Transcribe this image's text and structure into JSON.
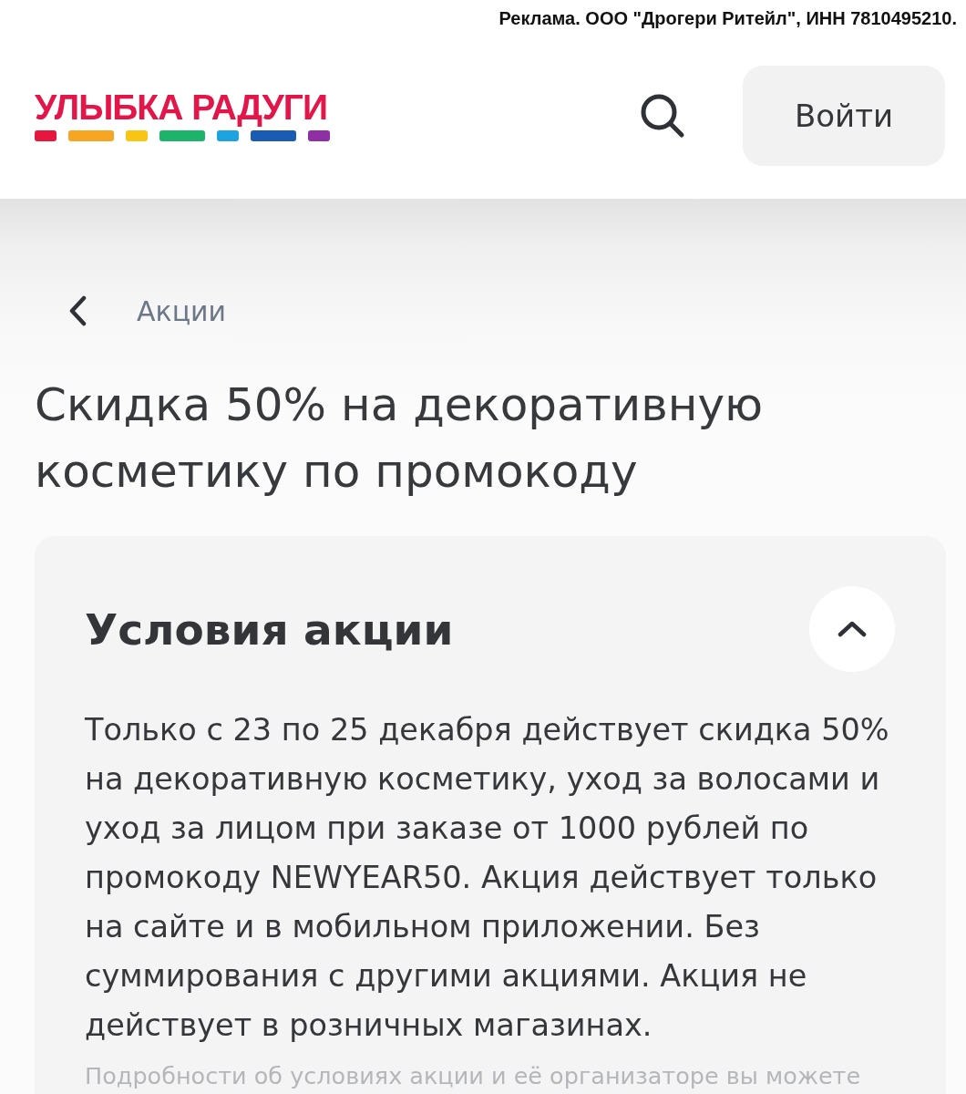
{
  "ad_notice": "Реклама. ООО \"Дрогери Ритейл\", ИНН 7810495210.",
  "header": {
    "logo_text": "УЛЫБКА РАДУГИ",
    "login_button": "Войти"
  },
  "breadcrumb": {
    "label": "Акции"
  },
  "title": "Скидка 50% на декоративную косметику по промокоду",
  "conditions": {
    "heading": "Условия акции",
    "expanded": true,
    "text": "Только с 23 по 25 декабря действует скидка 50% на декоративную косметику, уход за волосами и уход за лицом при заказе от 1000 рублей по промокоду NEWYEAR50. Акция действует только на сайте и в мобильном приложении. Без суммирования с другими акциями. Акция не действует в розничных магазинах.",
    "footnote": "Подробности об условиях акции и её организаторе вы можете"
  }
}
